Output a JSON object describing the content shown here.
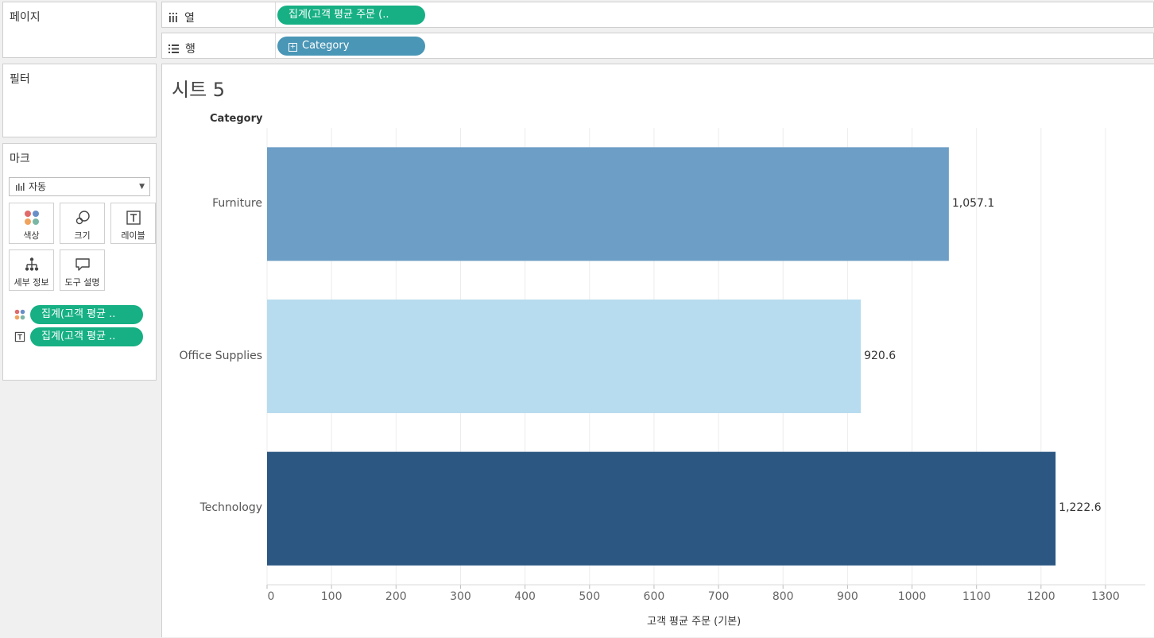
{
  "pages_panel": {
    "title": "페이지"
  },
  "filters_panel": {
    "title": "필터"
  },
  "columns_shelf": {
    "icon": "columns-icon",
    "label": "열",
    "pill": "집계(고객 평균 주문 (..",
    "pill_color": "#16b084"
  },
  "rows_shelf": {
    "icon": "rows-icon",
    "label": "행",
    "pill": "Category",
    "pill_color": "#4a96b6"
  },
  "marks": {
    "title": "마크",
    "type_label": "자동",
    "buttons": [
      {
        "name": "color",
        "label": "색상",
        "icon": "color-dots-icon"
      },
      {
        "name": "size",
        "label": "크기",
        "icon": "size-icon"
      },
      {
        "name": "label",
        "label": "레이블",
        "icon": "label-icon"
      },
      {
        "name": "detail",
        "label": "세부 정보",
        "icon": "detail-icon"
      },
      {
        "name": "tooltip",
        "label": "도구 설명",
        "icon": "tooltip-icon"
      }
    ],
    "fields": [
      {
        "icon": "color-dots-icon",
        "label": "집계(고객 평균 .."
      },
      {
        "icon": "label-icon",
        "label": "집계(고객 평균 .."
      }
    ]
  },
  "sheet": {
    "title": "시트 5"
  },
  "chart_data": {
    "type": "bar",
    "orientation": "horizontal",
    "row_header": "Category",
    "categories": [
      "Furniture",
      "Office Supplies",
      "Technology"
    ],
    "values": [
      1057.1,
      920.6,
      1222.6
    ],
    "value_labels": [
      "1,057.1",
      "920.6",
      "1,222.6"
    ],
    "colors": [
      "#6d9ec6",
      "#b7dcef",
      "#2c5783"
    ],
    "xlabel": "고객 평균 주문 (기본)",
    "xlim": [
      0,
      1300
    ],
    "xticks": [
      "0",
      "100",
      "200",
      "300",
      "400",
      "500",
      "600",
      "700",
      "800",
      "900",
      "1000",
      "1100",
      "1200",
      "1300"
    ],
    "grid": true
  }
}
